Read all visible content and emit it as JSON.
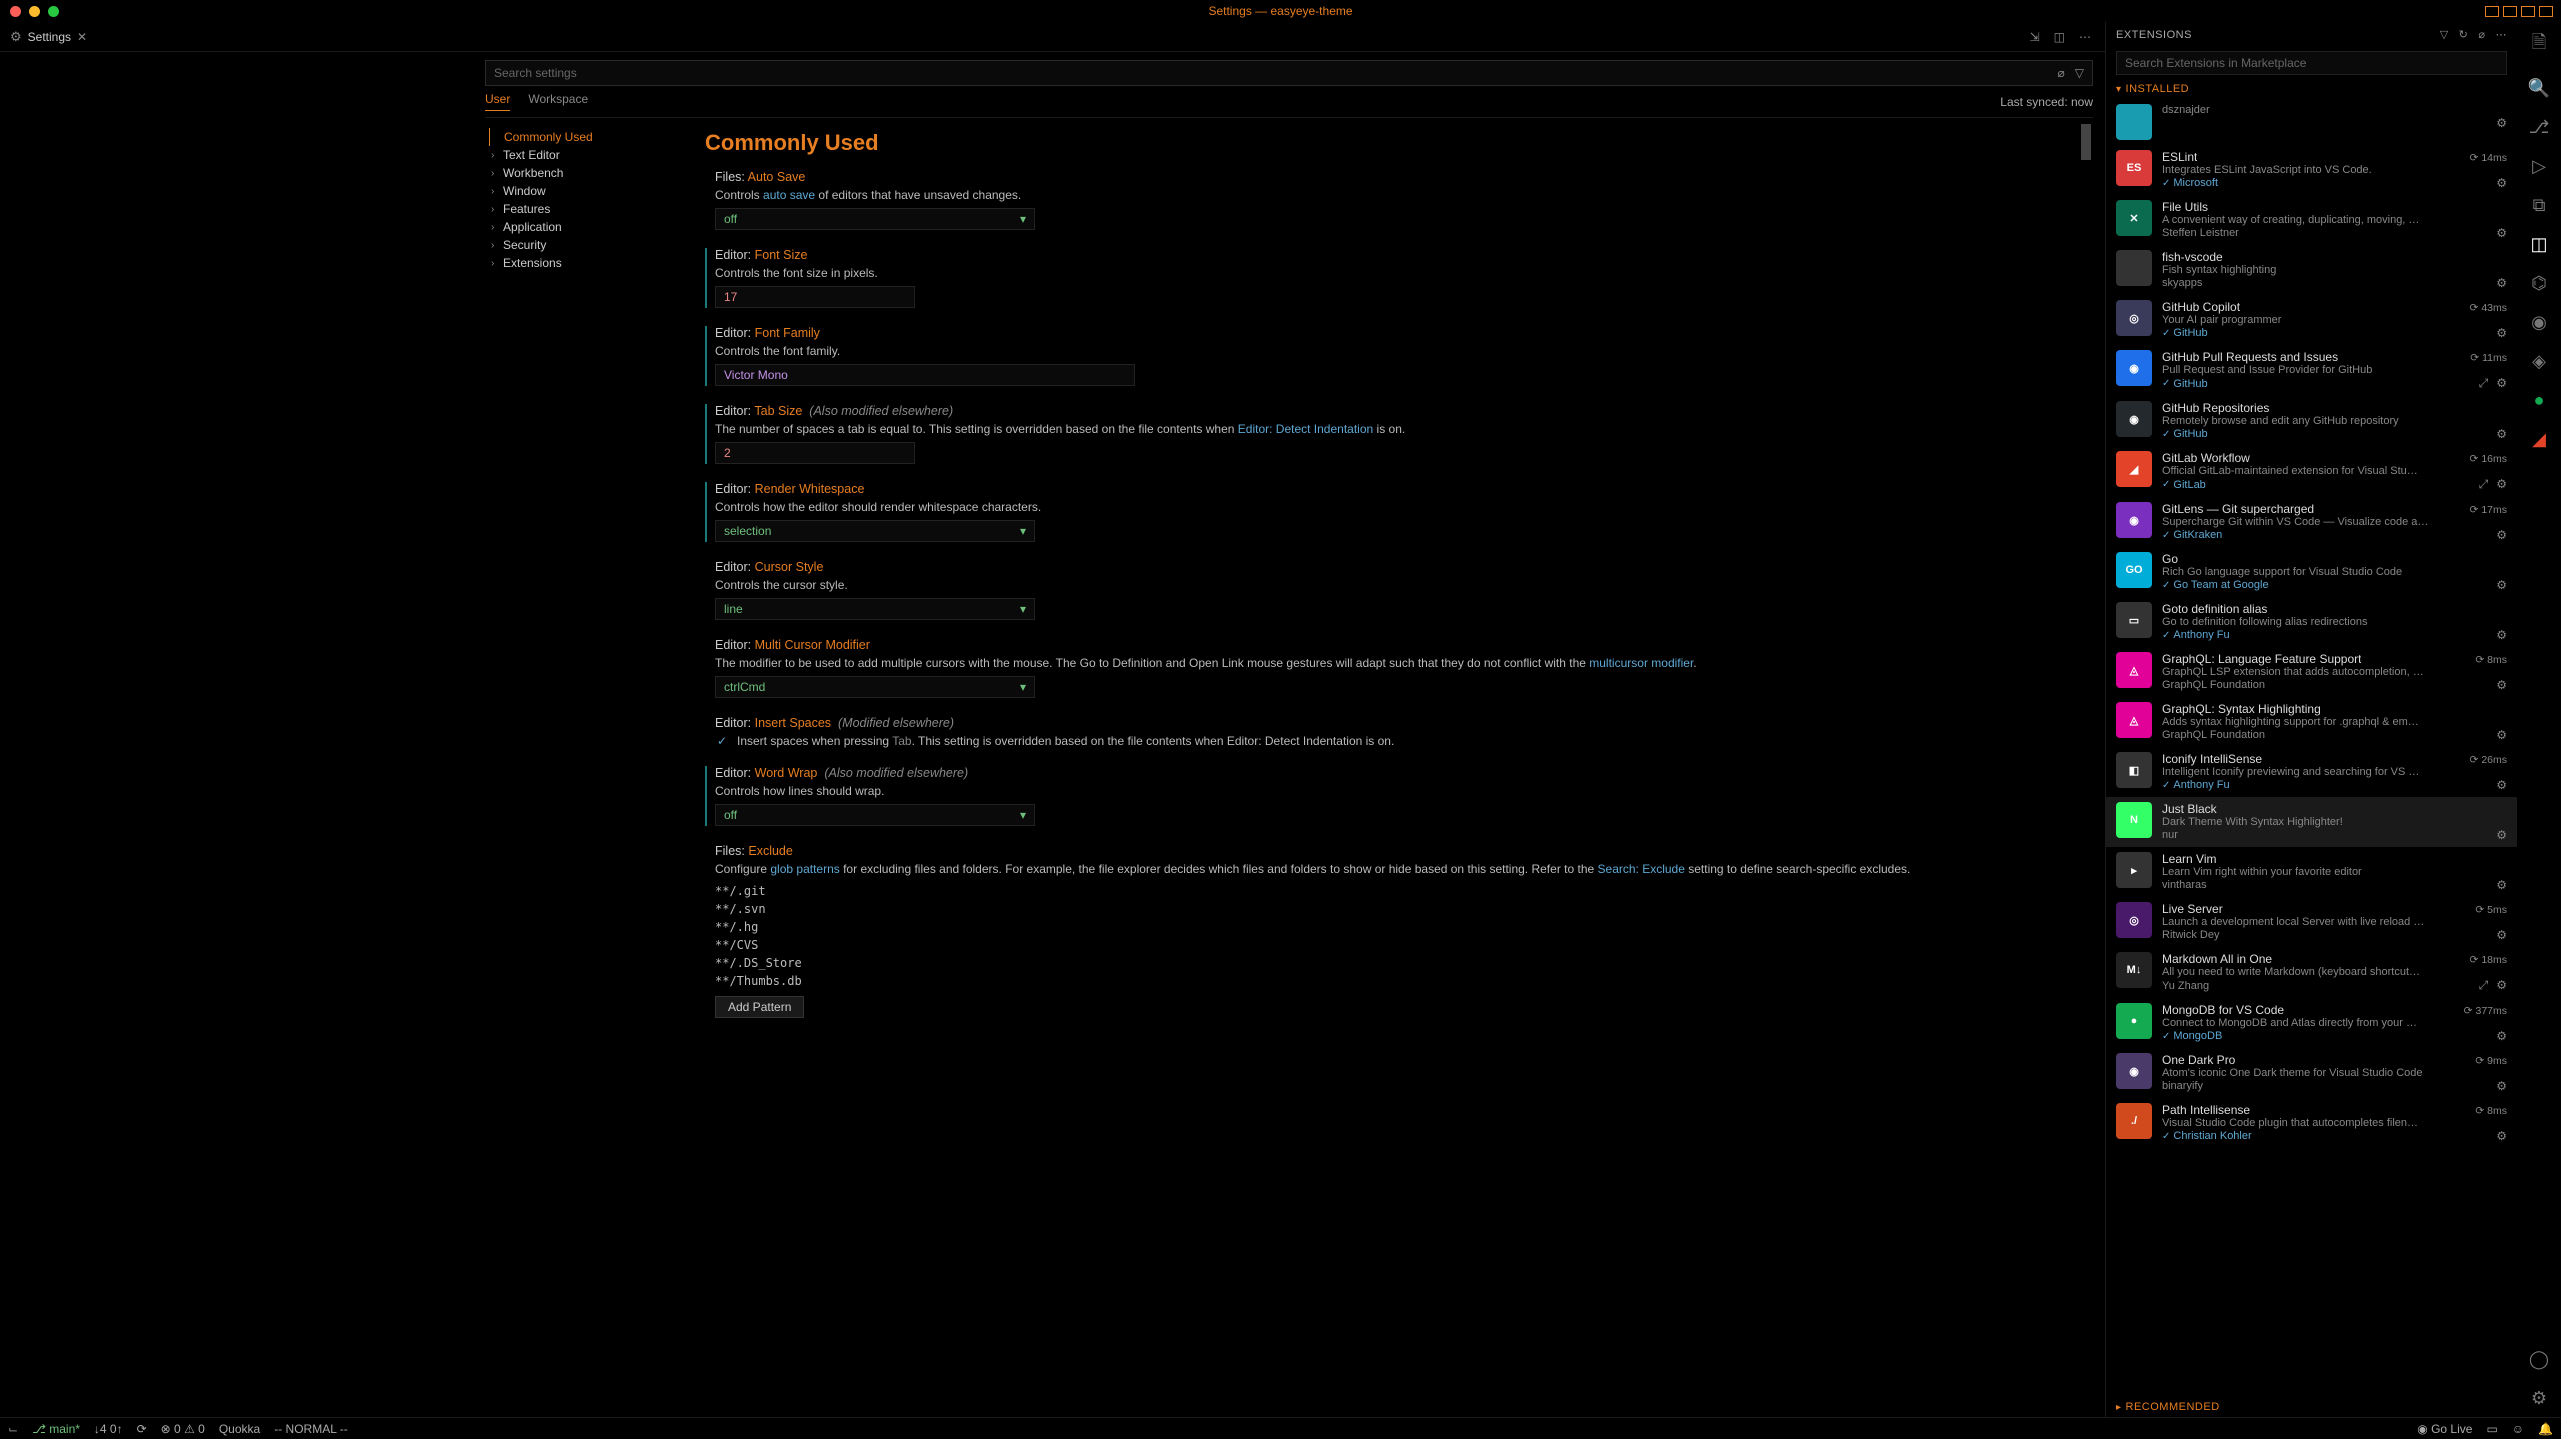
{
  "titlebar": {
    "title": "Settings — easyeye-theme"
  },
  "tab": {
    "label": "Settings"
  },
  "search": {
    "placeholder": "Search settings"
  },
  "scope": {
    "user": "User",
    "workspace": "Workspace",
    "sync_status": "Last synced: now"
  },
  "toc": [
    {
      "label": "Commonly Used",
      "active": true,
      "expandable": false
    },
    {
      "label": "Text Editor",
      "expandable": true
    },
    {
      "label": "Workbench",
      "expandable": true
    },
    {
      "label": "Window",
      "expandable": true
    },
    {
      "label": "Features",
      "expandable": true
    },
    {
      "label": "Application",
      "expandable": true
    },
    {
      "label": "Security",
      "expandable": true
    },
    {
      "label": "Extensions",
      "expandable": true
    }
  ],
  "section_title": "Commonly Used",
  "settings": {
    "auto_save": {
      "scope": "Files:",
      "name": "Auto Save",
      "desc_pre": "Controls ",
      "desc_link": "auto save",
      "desc_post": " of editors that have unsaved changes.",
      "value": "off"
    },
    "font_size": {
      "scope": "Editor:",
      "name": "Font Size",
      "desc": "Controls the font size in pixels.",
      "value": "17"
    },
    "font_family": {
      "scope": "Editor:",
      "name": "Font Family",
      "desc": "Controls the font family.",
      "value": "Victor Mono"
    },
    "tab_size": {
      "scope": "Editor:",
      "name": "Tab Size",
      "mod_note": "(Also modified elsewhere)",
      "desc_pre": "The number of spaces a tab is equal to. This setting is overridden based on the file contents when ",
      "desc_link": "Editor: Detect Indentation",
      "desc_post": " is on.",
      "value": "2"
    },
    "render_whitespace": {
      "scope": "Editor:",
      "name": "Render Whitespace",
      "desc": "Controls how the editor should render whitespace characters.",
      "value": "selection"
    },
    "cursor_style": {
      "scope": "Editor:",
      "name": "Cursor Style",
      "desc": "Controls the cursor style.",
      "value": "line"
    },
    "multi_cursor": {
      "scope": "Editor:",
      "name": "Multi Cursor Modifier",
      "desc_pre": "The modifier to be used to add multiple cursors with the mouse. The Go to Definition and Open Link mouse gestures will adapt such that they do not conflict with the ",
      "desc_link": "multicursor modifier",
      "desc_post": ".",
      "value": "ctrlCmd"
    },
    "insert_spaces": {
      "scope": "Editor:",
      "name": "Insert Spaces",
      "mod_note": "(Modified elsewhere)",
      "desc_pre": "Insert spaces when pressing ",
      "kbd": "Tab",
      "desc_mid": ". This setting is overridden based on the file contents when ",
      "desc_link": "Editor: Detect Indentation",
      "desc_post": " is on."
    },
    "word_wrap": {
      "scope": "Editor:",
      "name": "Word Wrap",
      "mod_note": "(Also modified elsewhere)",
      "desc": "Controls how lines should wrap.",
      "value": "off"
    },
    "exclude": {
      "scope": "Files:",
      "name": "Exclude",
      "desc_pre": "Configure ",
      "desc_link1": "glob patterns",
      "desc_mid": " for excluding files and folders. For example, the file explorer decides which files and folders to show or hide based on this setting. Refer to the ",
      "desc_link2": "Search: Exclude",
      "desc_post": " setting to define search-specific excludes.",
      "patterns": [
        "**/.git",
        "**/.svn",
        "**/.hg",
        "**/CVS",
        "**/.DS_Store",
        "**/Thumbs.db"
      ],
      "add_button": "Add Pattern"
    }
  },
  "panel": {
    "title": "EXTENSIONS",
    "search_placeholder": "Search Extensions in Marketplace",
    "installed_label": "INSTALLED",
    "recommended_label": "RECOMMENDED"
  },
  "extensions": [
    {
      "name": "",
      "desc": "dsznajder",
      "pub": "",
      "time": "",
      "icon_bg": "#1a9cb0",
      "icon_txt": "",
      "plain_pub": true
    },
    {
      "name": "ESLint",
      "desc": "Integrates ESLint JavaScript into VS Code.",
      "pub": "Microsoft",
      "time": "14ms",
      "icon_bg": "#d93a3a",
      "icon_txt": "ES",
      "verified": true
    },
    {
      "name": "File Utils",
      "desc": "A convenient way of creating, duplicating, moving, …",
      "pub": "Steffen Leistner",
      "time": "",
      "icon_bg": "#0a6b4f",
      "icon_txt": "✕",
      "plain_pub": true
    },
    {
      "name": "fish-vscode",
      "desc": "Fish syntax highlighting",
      "pub": "skyapps",
      "time": "",
      "icon_bg": "#333",
      "icon_txt": "",
      "plain_pub": true
    },
    {
      "name": "GitHub Copilot",
      "desc": "Your AI pair programmer",
      "pub": "GitHub",
      "time": "43ms",
      "icon_bg": "#3a3a5a",
      "icon_txt": "◎",
      "verified": true
    },
    {
      "name": "GitHub Pull Requests and Issues",
      "desc": "Pull Request and Issue Provider for GitHub",
      "pub": "GitHub",
      "time": "11ms",
      "icon_bg": "#1f6feb",
      "icon_txt": "◉",
      "verified": true,
      "double_action": true
    },
    {
      "name": "GitHub Repositories",
      "desc": "Remotely browse and edit any GitHub repository",
      "pub": "GitHub",
      "time": "",
      "icon_bg": "#24292e",
      "icon_txt": "◉",
      "verified": true
    },
    {
      "name": "GitLab Workflow",
      "desc": "Official GitLab-maintained extension for Visual Stu…",
      "pub": "GitLab",
      "time": "16ms",
      "icon_bg": "#e24329",
      "icon_txt": "◢",
      "verified": true,
      "double_action": true
    },
    {
      "name": "GitLens — Git supercharged",
      "desc": "Supercharge Git within VS Code — Visualize code a…",
      "pub": "GitKraken",
      "time": "17ms",
      "icon_bg": "#7b2fbf",
      "icon_txt": "◉",
      "verified": true
    },
    {
      "name": "Go",
      "desc": "Rich Go language support for Visual Studio Code",
      "pub": "Go Team at Google",
      "time": "",
      "icon_bg": "#00add8",
      "icon_txt": "GO",
      "verified": true
    },
    {
      "name": "Goto definition alias",
      "desc": "Go to definition following alias redirections",
      "pub": "Anthony Fu",
      "time": "",
      "icon_bg": "#333",
      "icon_txt": "▭",
      "verified": true
    },
    {
      "name": "GraphQL: Language Feature Support",
      "desc": "GraphQL LSP extension that adds autocompletion, …",
      "pub": "GraphQL Foundation",
      "time": "8ms",
      "icon_bg": "#e10098",
      "icon_txt": "◬",
      "plain_pub": true
    },
    {
      "name": "GraphQL: Syntax Highlighting",
      "desc": "Adds syntax highlighting support for .graphql & em…",
      "pub": "GraphQL Foundation",
      "time": "",
      "icon_bg": "#e10098",
      "icon_txt": "◬",
      "plain_pub": true
    },
    {
      "name": "Iconify IntelliSense",
      "desc": "Intelligent Iconify previewing and searching for VS …",
      "pub": "Anthony Fu",
      "time": "26ms",
      "icon_bg": "#333",
      "icon_txt": "◧",
      "verified": true
    },
    {
      "name": "Just Black",
      "desc": "Dark Theme With Syntax Highlighter!",
      "pub": "nur",
      "time": "",
      "icon_bg": "#33ff66",
      "icon_txt": "N",
      "selected": true,
      "plain_pub": true
    },
    {
      "name": "Learn Vim",
      "desc": "Learn Vim right within your favorite editor",
      "pub": "vintharas",
      "time": "",
      "icon_bg": "#333",
      "icon_txt": "▸",
      "plain_pub": true
    },
    {
      "name": "Live Server",
      "desc": "Launch a development local Server with live reload …",
      "pub": "Ritwick Dey",
      "time": "5ms",
      "icon_bg": "#4a1a6a",
      "icon_txt": "◎",
      "plain_pub": true
    },
    {
      "name": "Markdown All in One",
      "desc": "All you need to write Markdown (keyboard shortcut…",
      "pub": "Yu Zhang",
      "time": "18ms",
      "icon_bg": "#222",
      "icon_txt": "M↓",
      "plain_pub": true,
      "double_action": true
    },
    {
      "name": "MongoDB for VS Code",
      "desc": "Connect to MongoDB and Atlas directly from your …",
      "pub": "MongoDB",
      "time": "377ms",
      "icon_bg": "#13aa52",
      "icon_txt": "●",
      "verified": true
    },
    {
      "name": "One Dark Pro",
      "desc": "Atom's iconic One Dark theme for Visual Studio Code",
      "pub": "binaryify",
      "time": "9ms",
      "icon_bg": "#4a3a6a",
      "icon_txt": "◉",
      "plain_pub": true
    },
    {
      "name": "Path Intellisense",
      "desc": "Visual Studio Code plugin that autocompletes filen…",
      "pub": "Christian Kohler",
      "time": "8ms",
      "icon_bg": "#d04a1e",
      "icon_txt": "./",
      "verified": true
    }
  ],
  "statusbar": {
    "branch": "main*",
    "sync": "↓4 0↑",
    "errors": "⊗ 0 ⚠ 0",
    "quokka": "Quokka",
    "vim": "-- NORMAL --",
    "golive": "Go Live"
  }
}
